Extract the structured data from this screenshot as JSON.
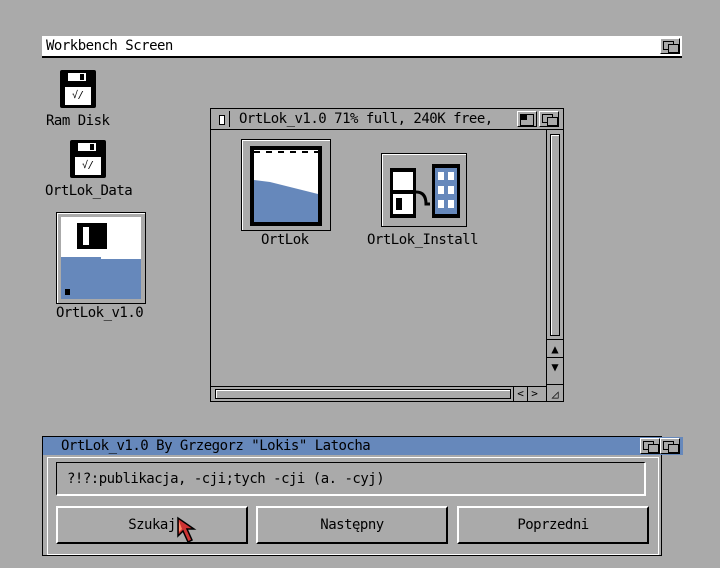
{
  "screen": {
    "title": "Workbench Screen"
  },
  "desktop_icons": [
    {
      "label": "Ram Disk"
    },
    {
      "label": "OrtLok_Data"
    },
    {
      "label": "OrtLok_v1.0"
    }
  ],
  "drawer_window": {
    "title": "OrtLok_v1.0  71% full, 240K free,",
    "icons": [
      {
        "label": "OrtLok"
      },
      {
        "label": "OrtLok_Install"
      }
    ]
  },
  "dialog": {
    "title": "OrtLok_v1.0   By Grzegorz \"Lokis\" Latocha",
    "search_value": "?!?:publikacja, -cji;tych -cji (a. -cyj)",
    "buttons": {
      "search": "Szukaj",
      "next": "Następny",
      "previous": "Poprzedni"
    }
  },
  "colors": {
    "background": "#aaaaaa",
    "accent_blue": "#6688bb",
    "white": "#ffffff",
    "black": "#000000"
  }
}
